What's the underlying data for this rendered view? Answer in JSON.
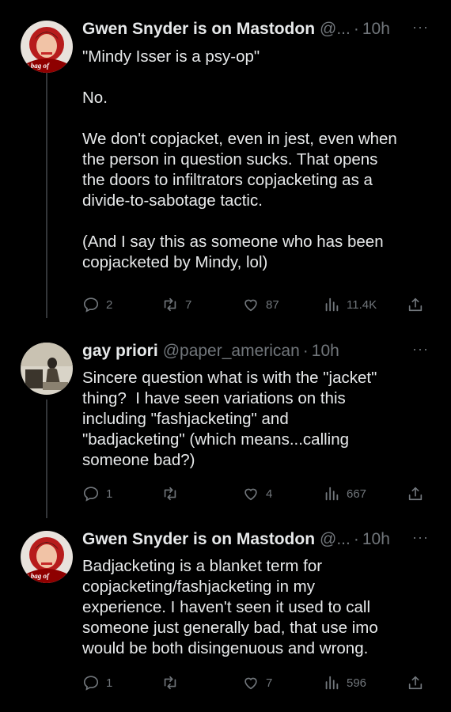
{
  "tweets": [
    {
      "name": "Gwen Snyder is on Mastodon",
      "handle": "@...",
      "sep": "·",
      "time": "10h",
      "more": "···",
      "avatar_text": "a bag of",
      "body": "\"Mindy Isser is a psy-op\"\n\nNo.\n\nWe don't copjacket, even in jest, even when\nthe person in question sucks. That opens\nthe doors to infiltrators copjacketing as a\ndivide-to-sabotage tactic.\n\n(And I say this as someone who has been\ncopjacketed by Mindy, lol)",
      "replies": "2",
      "retweets": "7",
      "likes": "87",
      "views": "11.4K"
    },
    {
      "name": "gay priori",
      "handle": "@paper_american",
      "sep": "·",
      "time": "10h",
      "more": "···",
      "avatar_text": "",
      "body": "Sincere question what is with the \"jacket\"\nthing?  I have seen variations on this\nincluding \"fashjacketing\" and\n\"badjacketing\" (which means...calling\nsomeone bad?)",
      "replies": "1",
      "retweets": "",
      "likes": "4",
      "views": "667"
    },
    {
      "name": "Gwen Snyder is on Mastodon",
      "handle": "@...",
      "sep": "·",
      "time": "10h",
      "more": "···",
      "avatar_text": "a bag of",
      "body": "Badjacketing is a blanket term for\ncopjacketing/fashjacketing in my\nexperience. I haven't seen it used to call\nsomeone just generally bad, that use imo\nwould be both disingenuous and wrong.",
      "replies": "1",
      "retweets": "",
      "likes": "7",
      "views": "596"
    }
  ],
  "icons": [
    "reply-icon",
    "retweet-icon",
    "like-icon",
    "views-icon",
    "share-icon",
    "more-icon"
  ],
  "colors": {
    "background": "#000000",
    "text": "#e7e9ea",
    "muted": "#71767b",
    "line": "#333639"
  }
}
